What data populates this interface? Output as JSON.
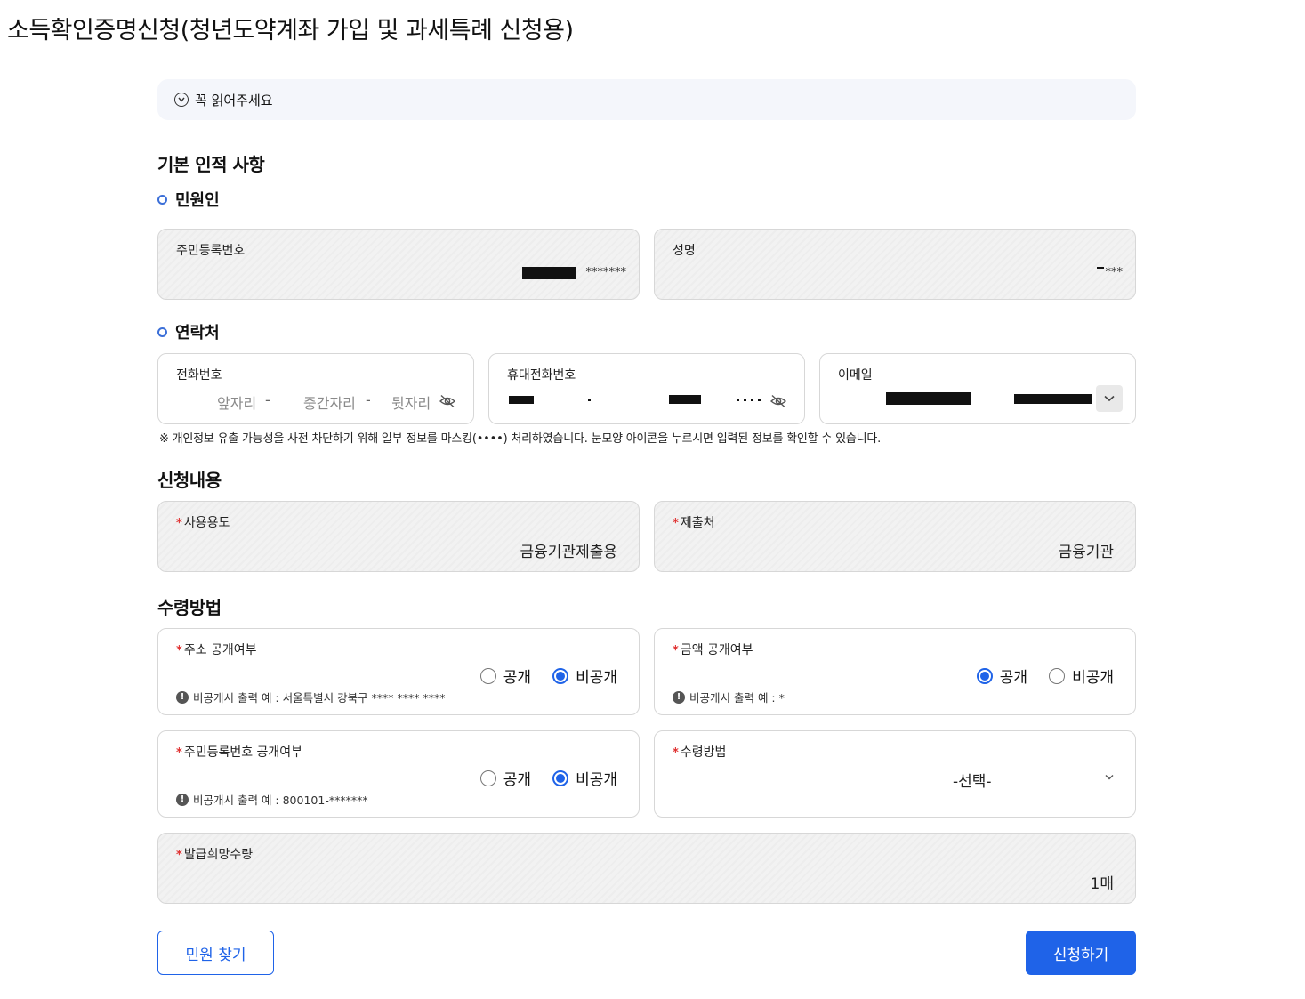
{
  "page_title": "소득확인증명신청(청년도약계좌 가입 및 과세특례 신청용)",
  "notice_label": "꼭 읽어주세요",
  "basic": {
    "title": "기본 인적 사항",
    "applicant_title": "민원인",
    "rrn_label": "주민등록번호",
    "rrn_suffix": "*******",
    "name_label": "성명",
    "name_value": "***"
  },
  "contact": {
    "title": "연락처",
    "phone_label": "전화번호",
    "phone_placeholders": [
      "앞자리",
      "중간자리",
      "뒷자리"
    ],
    "dash": "-",
    "mobile_label": "휴대전화번호",
    "email_label": "이메일",
    "note": "※ 개인정보 유출 가능성을 사전 차단하기 위해 일부 정보를 마스킹(••••) 처리하였습니다. 눈모양 아이콘을 누르시면 입력된 정보를 확인할 수 있습니다."
  },
  "request": {
    "title": "신청내용",
    "purpose_label": "사용용도",
    "purpose_value": "금융기관제출용",
    "submit_to_label": "제출처",
    "submit_to_value": "금융기관"
  },
  "receipt": {
    "title": "수령방법",
    "address_label": "주소 공개여부",
    "address_hint": "비공개시 출력 예 : 서울특별시 강북구 **** **** ****",
    "amount_label": "금액 공개여부",
    "amount_hint": "비공개시 출력 예 : *",
    "rrn_public_label": "주민등록번호 공개여부",
    "rrn_public_hint": "비공개시 출력 예 : 800101-*******",
    "method_label": "수령방법",
    "method_selected": "-선택-",
    "quantity_label": "발급희망수량",
    "quantity_value": "1매",
    "public": "공개",
    "private": "비공개",
    "required_mark": "*"
  },
  "buttons": {
    "find": "민원 찾기",
    "apply": "신청하기"
  },
  "colors": {
    "accent": "#1f63e8",
    "required": "#e03131",
    "readonly_bg": "#f2f2f2"
  }
}
